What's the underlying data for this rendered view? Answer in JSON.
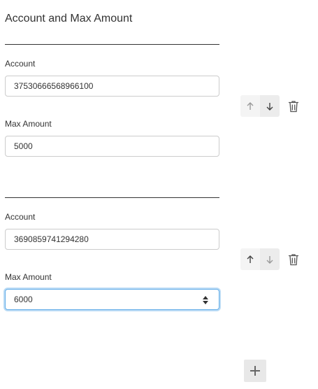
{
  "section": {
    "title": "Account and Max Amount"
  },
  "entries": [
    {
      "account_label": "Account",
      "account_value": "37530666568966100",
      "max_label": "Max Amount",
      "max_value": "5000"
    },
    {
      "account_label": "Account",
      "account_value": "3690859741294280",
      "max_label": "Max Amount",
      "max_value": "6000"
    }
  ],
  "icons": {
    "move_up": "arrow-up-icon",
    "move_down": "arrow-down-icon",
    "delete": "trash-icon",
    "add": "plus-icon",
    "spinner": "number-spinner-icon"
  },
  "colors": {
    "focus": "#66afe9",
    "text": "#333333",
    "border": "#cccccc"
  }
}
